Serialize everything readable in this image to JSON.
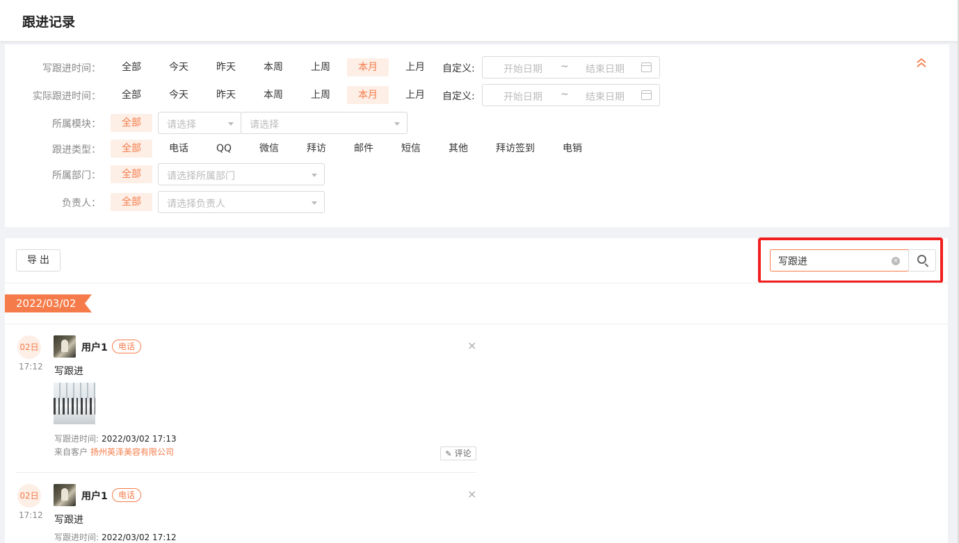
{
  "page": {
    "title": "跟进记录"
  },
  "filters": {
    "write_time": {
      "label": "写跟进时间：",
      "options": [
        "全部",
        "今天",
        "昨天",
        "本周",
        "上周",
        "本月",
        "上月"
      ],
      "active": "本月",
      "custom_label": "自定义:",
      "start_placeholder": "开始日期",
      "separator": "~",
      "end_placeholder": "结束日期"
    },
    "actual_time": {
      "label": "实际跟进时间：",
      "options": [
        "全部",
        "今天",
        "昨天",
        "本周",
        "上周",
        "本月",
        "上月"
      ],
      "active": "本月",
      "custom_label": "自定义:",
      "start_placeholder": "开始日期",
      "separator": "~",
      "end_placeholder": "结束日期"
    },
    "module": {
      "label": "所属模块：",
      "all": "全部",
      "select1_placeholder": "请选择",
      "select2_placeholder": "请选择"
    },
    "type": {
      "label": "跟进类型：",
      "options": [
        "全部",
        "电话",
        "QQ",
        "微信",
        "拜访",
        "邮件",
        "短信",
        "其他",
        "拜访签到",
        "电销"
      ],
      "active": "全部"
    },
    "department": {
      "label": "所属部门：",
      "all": "全部",
      "placeholder": "请选择所属部门"
    },
    "owner": {
      "label": "负责人：",
      "all": "全部",
      "placeholder": "请选择负责人"
    },
    "collapse_icon": "double-chevron-up-icon"
  },
  "toolbar": {
    "export_label": "导出",
    "search_value": "写跟进",
    "search_icon": "search-icon",
    "highlight_color": "#f11f1f"
  },
  "date_group": "2022/03/02",
  "records": [
    {
      "day": "02日",
      "time": "17:12",
      "user": "用户1",
      "tag": "电话",
      "content": "写跟进",
      "has_image": true,
      "write_time_label": "写跟进时间:",
      "write_time": "2022/03/02 17:13",
      "customer_label": "来自客户",
      "customer": "扬州英泽美容有限公司",
      "comment_label": "评论"
    },
    {
      "day": "02日",
      "time": "17:12",
      "user": "用户1",
      "tag": "电话",
      "content": "写跟进",
      "write_time_label": "写跟进时间:",
      "write_time": "2022/03/02 17:12"
    }
  ],
  "colors": {
    "accent": "#f57c4a",
    "accent_bg": "#fdeee6"
  }
}
